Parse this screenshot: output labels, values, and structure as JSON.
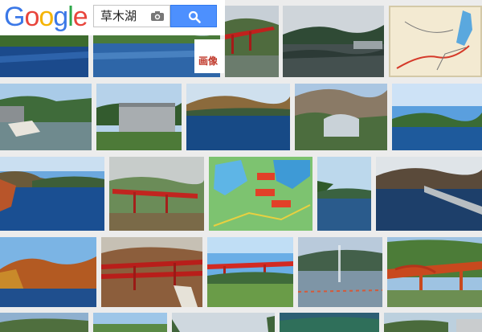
{
  "logo": {
    "letters": [
      "G",
      "o",
      "o",
      "g",
      "l",
      "e"
    ],
    "colors": [
      "#3b78e7",
      "#e8453c",
      "#f5b400",
      "#3b78e7",
      "#2ea84a",
      "#e8453c"
    ]
  },
  "search": {
    "query": "草木湖"
  },
  "tabs": {
    "images_label": "画像"
  },
  "colors": {
    "search_button": "#4d90fe",
    "images_tab_text": "#c0392b"
  },
  "image_results": [
    {
      "name": "dam-lake-blue"
    },
    {
      "name": "lake-hills"
    },
    {
      "name": "red-bridge-autumn"
    },
    {
      "name": "lake-reflection"
    },
    {
      "name": "area-map"
    },
    {
      "name": "dam-river-rocks"
    },
    {
      "name": "dam-wall-green"
    },
    {
      "name": "lake-mountains"
    },
    {
      "name": "arch-dam"
    },
    {
      "name": "lake-blue-sky"
    },
    {
      "name": "lake-autumn-clouds"
    },
    {
      "name": "red-bridge-fog"
    },
    {
      "name": "tourist-map"
    },
    {
      "name": "lake-forest"
    },
    {
      "name": "dam-road-lake"
    },
    {
      "name": "autumn-hillside-lake"
    },
    {
      "name": "red-bridge-grass"
    },
    {
      "name": "red-bridge-sky"
    },
    {
      "name": "fountain-lake"
    },
    {
      "name": "red-bridge-closeup"
    },
    {
      "name": "hillside"
    },
    {
      "name": "lake-bottom-1"
    },
    {
      "name": "trees-bottom"
    },
    {
      "name": "green-lake-bottom"
    },
    {
      "name": "dam-bottom"
    }
  ]
}
